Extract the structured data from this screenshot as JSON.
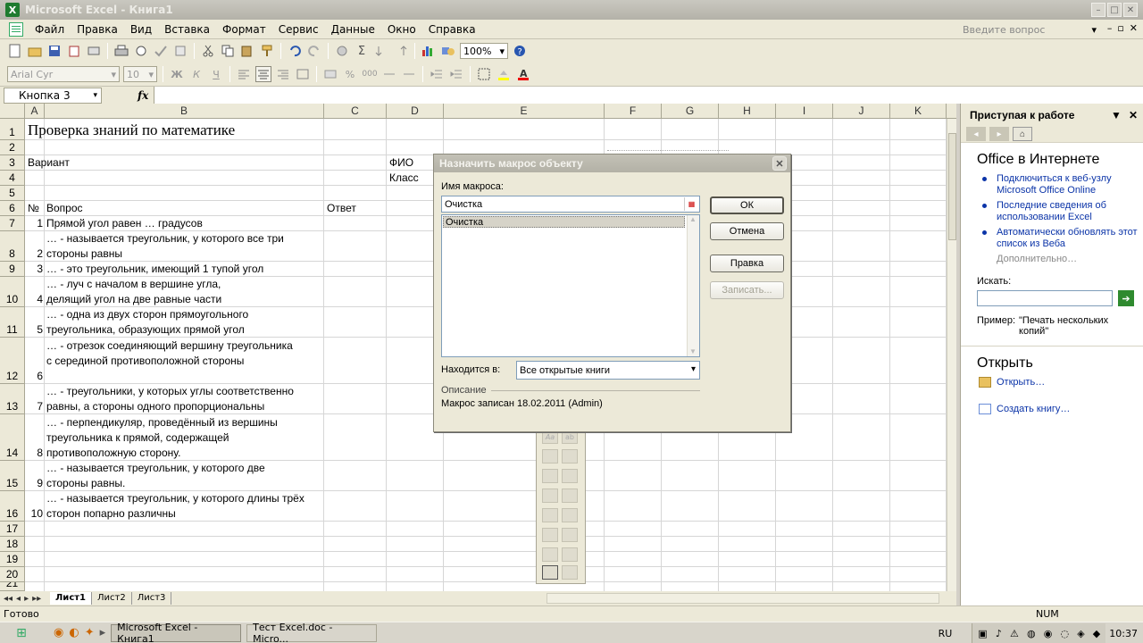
{
  "window": {
    "title": "Microsoft Excel - Книга1",
    "app_icon_letter": "X",
    "minimize": "–",
    "maximize": "□",
    "close": "✕"
  },
  "menu": {
    "items": [
      "Файл",
      "Правка",
      "Вид",
      "Вставка",
      "Формат",
      "Сервис",
      "Данные",
      "Окно",
      "Справка"
    ],
    "ask_placeholder": "Введите вопрос",
    "ask_arrow": "▾",
    "doc_minimize": "–",
    "doc_restore": "▫",
    "doc_close": "✕"
  },
  "toolbar": {
    "zoom": "100%",
    "font": "Arial Cyr",
    "font_size": "10",
    "bold": "Ж",
    "italic": "К",
    "underline": "Ч",
    "sigma": "Σ",
    "percent": "%",
    "thousands": "000",
    "font_color_glyph": "A",
    "help": "?",
    "combo_arrow": "▾"
  },
  "formula_bar": {
    "name_box": "Кнопка 3",
    "fx": "fx",
    "name_arrow": "▾"
  },
  "columns": [
    "A",
    "B",
    "C",
    "D",
    "E",
    "F",
    "G",
    "H",
    "I",
    "J",
    "K"
  ],
  "rows": [
    "1",
    "2",
    "3",
    "4",
    "5",
    "6",
    "7",
    "8",
    "9",
    "10",
    "11",
    "12",
    "13",
    "14",
    "15",
    "16",
    "17",
    "18",
    "19",
    "20",
    "21"
  ],
  "cells": {
    "title": "Проверка знаний по математике",
    "variant": "Вариант",
    "fio": "ФИО",
    "klass": "Класс",
    "no": "№",
    "vopros": "Вопрос",
    "otvet": "Ответ",
    "questions": [
      {
        "n": "1",
        "text": "Прямой угол равен … градусов"
      },
      {
        "n": "2",
        "text": "… - называется треугольник, у которого все три стороны равны"
      },
      {
        "n": "3",
        "text": "… - это треугольник, имеющий 1 тупой угол"
      },
      {
        "n": "4",
        "text": "… - луч с началом в вершине угла, делящий угол на две равные части"
      },
      {
        "n": "5",
        "text": "… - одна из двух сторон прямоугольного треугольника, образующих прямой угол"
      },
      {
        "n": "6",
        "text": "… - отрезок соединяющий вершину треугольника с серединой противоположной стороны"
      },
      {
        "n": "7",
        "text": "… - треугольники, у которых углы соответственно равны, а стороны одного пропорциональны"
      },
      {
        "n": "8",
        "text": "… - перпендикуляр, проведённый из вершины треугольника к прямой, содержащей противоположную сторону."
      },
      {
        "n": "9",
        "text": "… - называется треугольник, у которого две стороны равны."
      },
      {
        "n": "10",
        "text": "… - называется треугольник, у которого длины трёх сторон попарно различны"
      }
    ]
  },
  "sheet_tabs": {
    "nav": [
      "◂◂",
      "◂",
      "▸",
      "▸▸"
    ],
    "tabs": [
      "Лист1",
      "Лист2",
      "Лист3"
    ]
  },
  "status": {
    "ready": "Готово",
    "num": "NUM"
  },
  "taskbar": {
    "start_glyph": "⊞",
    "quick_launch": [
      "◉",
      "◐",
      "✦",
      "▸"
    ],
    "tasks": [
      "Microsoft Excel - Книга1",
      "Тест Excel.doc - Micro..."
    ],
    "lang": "RU",
    "tray_icons": [
      "▣",
      "♪",
      "⚠",
      "◍",
      "◉",
      "◌",
      "◈",
      "◆"
    ],
    "clock": "10:37"
  },
  "task_pane": {
    "title": "Приступая к работе",
    "menu_arrow": "▼",
    "close": "✕",
    "nav_back": "◂",
    "nav_forward": "▸",
    "nav_home": "⌂",
    "section_office": "Office в Интернете",
    "links": [
      "Подключиться к веб-узлу Microsoft Office Online",
      "Последние сведения об использовании Excel",
      "Автоматически обновлять этот список из Веба"
    ],
    "more": "Дополнительно…",
    "search_label": "Искать:",
    "search_value": "",
    "go_glyph": "➔",
    "example_label": "Пример:",
    "example_value": "\"Печать нескольких копий\"",
    "section_open": "Открыть",
    "open_link": "Открыть…",
    "create_link": "Создать книгу…"
  },
  "forms_toolbar": {
    "label_glyph": "Aa",
    "edit_glyph": "ab"
  },
  "dialog": {
    "title": "Назначить макрос объекту",
    "close": "✕",
    "macro_name_label": "Имя макроса:",
    "macro_name_value": "Очистка",
    "picker_glyph": "▦",
    "macro_list": [
      "Очистка"
    ],
    "list_scroll_up": "▲",
    "list_scroll_down": "▼",
    "buttons": {
      "ok": "ОК",
      "cancel": "Отмена",
      "edit": "Правка",
      "record": "Записать..."
    },
    "location_label": "Находится в:",
    "location_value": "Все открытые книги",
    "location_arrow": "▾",
    "description_label": "Описание",
    "description_value": "Макрос записан 18.02.2011 (Admin)"
  }
}
